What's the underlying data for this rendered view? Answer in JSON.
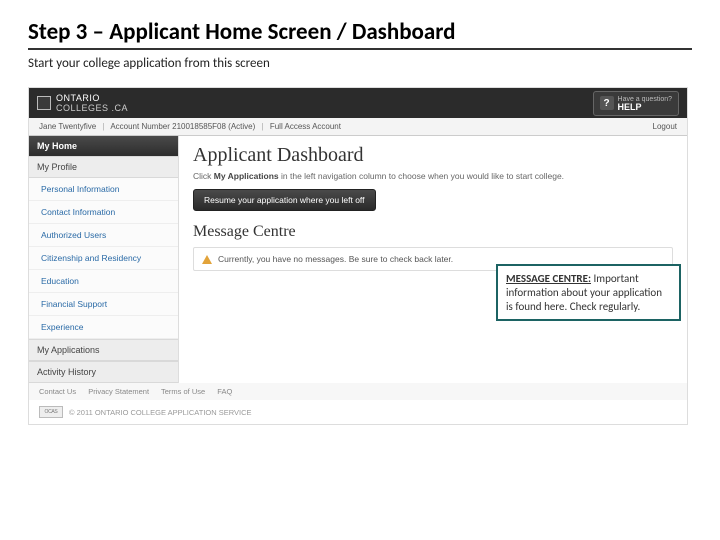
{
  "slide": {
    "title": "Step 3 – Applicant Home Screen / Dashboard",
    "subtitle": "Start your college application from this screen"
  },
  "header": {
    "logo_main": "ONTARIO",
    "logo_sub": "COLLEGES",
    "logo_tld": ".CA",
    "help_question": "Have a question?",
    "help_label": "HELP",
    "help_glyph": "?"
  },
  "account": {
    "name": "Jane Twentyfive",
    "acct_label": "Account Number 210018585F08  (Active)",
    "access": "Full  Access Account",
    "logout": "Logout"
  },
  "sidebar": {
    "home": "My Home",
    "profile_header": "My Profile",
    "items": [
      "Personal Information",
      "Contact Information",
      "Authorized Users",
      "Citizenship and Residency",
      "Education",
      "Financial Support",
      "Experience"
    ],
    "apps_header": "My Applications",
    "activity_header": "Activity History"
  },
  "dashboard": {
    "title": "Applicant Dashboard",
    "instruction_prefix": "Click ",
    "instruction_bold": "My Applications",
    "instruction_suffix": " in the left navigation column to choose when you would like to start college.",
    "resume_btn": "Resume your application where you left off",
    "mc_title": "Message Centre",
    "mc_msg": "Currently, you have no messages. Be sure to check back later."
  },
  "callout": {
    "head": "MESSAGE CENTRE:",
    "body": "Important information about your application is found here. Check regularly."
  },
  "footer": {
    "links": [
      "Contact Us",
      "Privacy Statement",
      "Terms of Use",
      "FAQ"
    ],
    "ocas": "OCAS",
    "copyright": "© 2011 ONTARIO COLLEGE APPLICATION SERVICE"
  }
}
